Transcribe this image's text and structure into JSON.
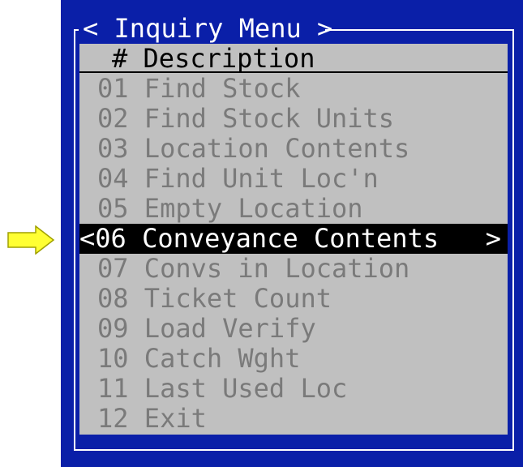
{
  "menu": {
    "title": "< Inquiry Menu >",
    "header": {
      "number_col": "#",
      "description_col": "Description"
    },
    "items": [
      {
        "label": "01 Find Stock"
      },
      {
        "label": "02 Find Stock Units"
      },
      {
        "label": "03 Location Contents"
      },
      {
        "label": "04 Find Unit Loc'n"
      },
      {
        "label": "05 Empty Location"
      },
      {
        "label": "06 Conveyance Contents",
        "selected": true,
        "prefix": "<",
        "suffix": ">"
      },
      {
        "label": "07 Convs in Location"
      },
      {
        "label": "08 Ticket Count"
      },
      {
        "label": "09 Load Verify"
      },
      {
        "label": "10 Catch Wght"
      },
      {
        "label": "11 Last Used Loc"
      },
      {
        "label": "12 Exit"
      }
    ]
  },
  "colors": {
    "background": "#0a1fa8",
    "panel": "#c0c0c0",
    "text": "#7a7a7a",
    "selection": "#000000",
    "pointer": "#ffff33"
  },
  "pointer": {
    "icon": "arrow-right-icon"
  }
}
